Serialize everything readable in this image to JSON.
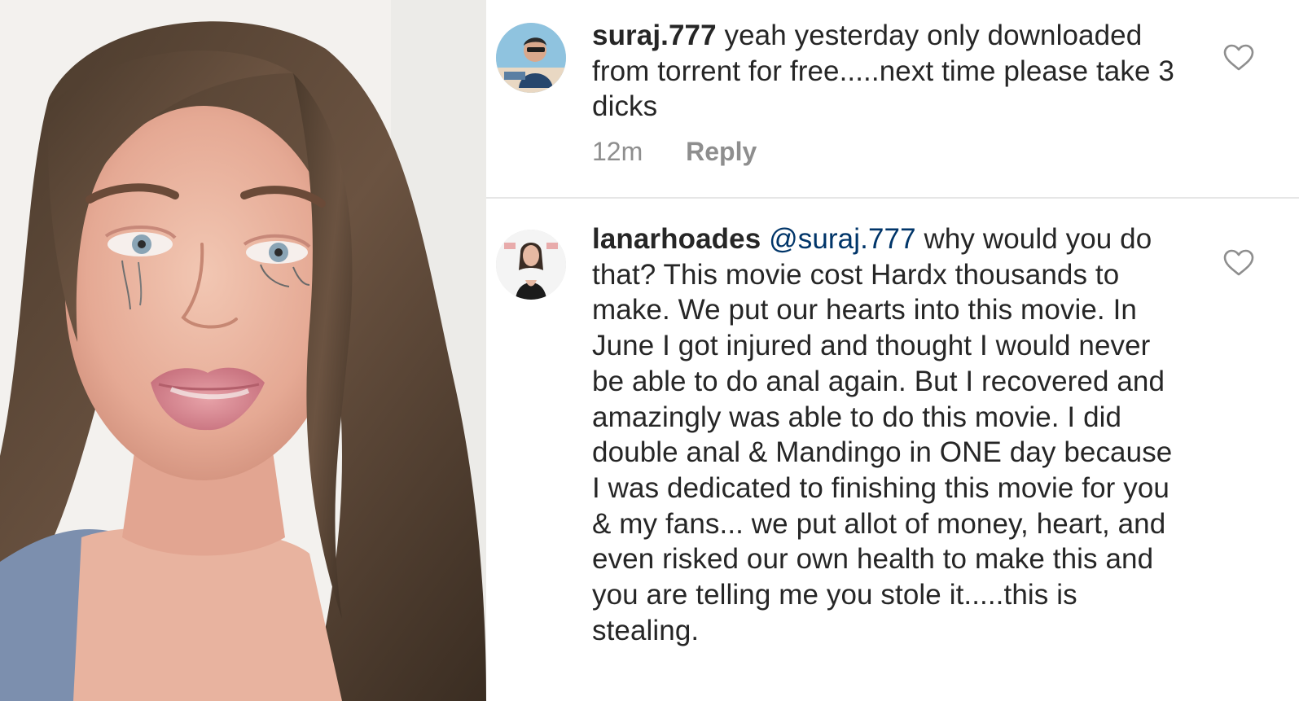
{
  "comments": [
    {
      "username": "suraj.777",
      "mention": "",
      "text": "yeah yesterday only downloaded from torrent for free.....next time please take 3 dicks",
      "time": "12m",
      "reply_label": "Reply",
      "icons": {
        "like": "heart-outline-icon",
        "avatar": "user-avatar"
      }
    },
    {
      "username": "lanarhoades",
      "mention": "@suraj.777",
      "text": "why would you do that? This movie cost Hardx thousands to make. We put our hearts into this movie. In June I got injured and thought I would never be able to do anal again. But I recovered and amazingly was able to do this movie. I did double anal & Mandingo in ONE day because I was dedicated to finishing this movie for you & my fans... we put allot of money, heart, and even risked our own health to make this and you are telling me you stole it.....this is stealing.",
      "icons": {
        "like": "heart-outline-icon",
        "avatar": "user-avatar"
      }
    }
  ],
  "colors": {
    "text": "#262626",
    "mention": "#003569",
    "meta": "#8e8e8e",
    "divider": "#e6e6e6"
  }
}
